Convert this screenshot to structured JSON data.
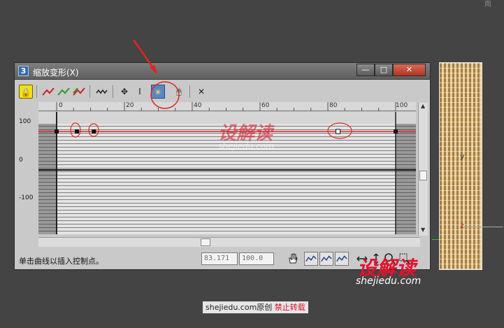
{
  "corner_char": "両",
  "window": {
    "app_icon_text": "3",
    "title": "缩放变形(X)",
    "min_label": "—",
    "max_label": "□",
    "close_label": "✕"
  },
  "toolbar": {
    "icons": {
      "lock": "lock-icon",
      "curve_red": "curve-red-icon",
      "curve_green": "curve-green-icon",
      "curve_both": "curve-both-icon",
      "wave": "wave-icon",
      "move": "move-icon",
      "scale_vertical": "scale-vertical-icon",
      "insert_point": "insert-corner-point-icon",
      "reset": "reset-curve-icon",
      "delete": "delete-point-icon"
    },
    "glyphs": {
      "lock": "🔒",
      "move": "✥",
      "scale_vertical": "I",
      "insert_point": "✳",
      "reset": "🖱",
      "delete": "✕"
    }
  },
  "graph": {
    "ruler_ticks": [
      "0",
      "20",
      "40",
      "60",
      "80",
      "100"
    ],
    "y_labels": [
      "100",
      "0",
      "-100"
    ],
    "curve_color": "#e0261f",
    "control_points": [
      {
        "position": 0,
        "value": 100,
        "type": "corner"
      },
      {
        "position": 6,
        "value": 100,
        "type": "corner"
      },
      {
        "position": 11,
        "value": 100,
        "type": "corner"
      },
      {
        "position": 83,
        "value": 100,
        "type": "selected-hollow"
      },
      {
        "position": 100,
        "value": 100,
        "type": "corner"
      }
    ]
  },
  "status": {
    "text": "单击曲线以插入控制点。",
    "x_value": "83.171",
    "y_value": "100.0"
  },
  "viewport": {
    "axis_y": "y",
    "axis_z": "z"
  },
  "watermark": {
    "brand": "设解读",
    "url": "shejiedu.com"
  },
  "credit": {
    "site": "shejiedu.com",
    "original": "原创",
    "forbid": "禁止转载"
  },
  "colors": {
    "annotation": "#e0261f",
    "lock_button": "#f4e10d",
    "active_button": "#5b86c2"
  }
}
